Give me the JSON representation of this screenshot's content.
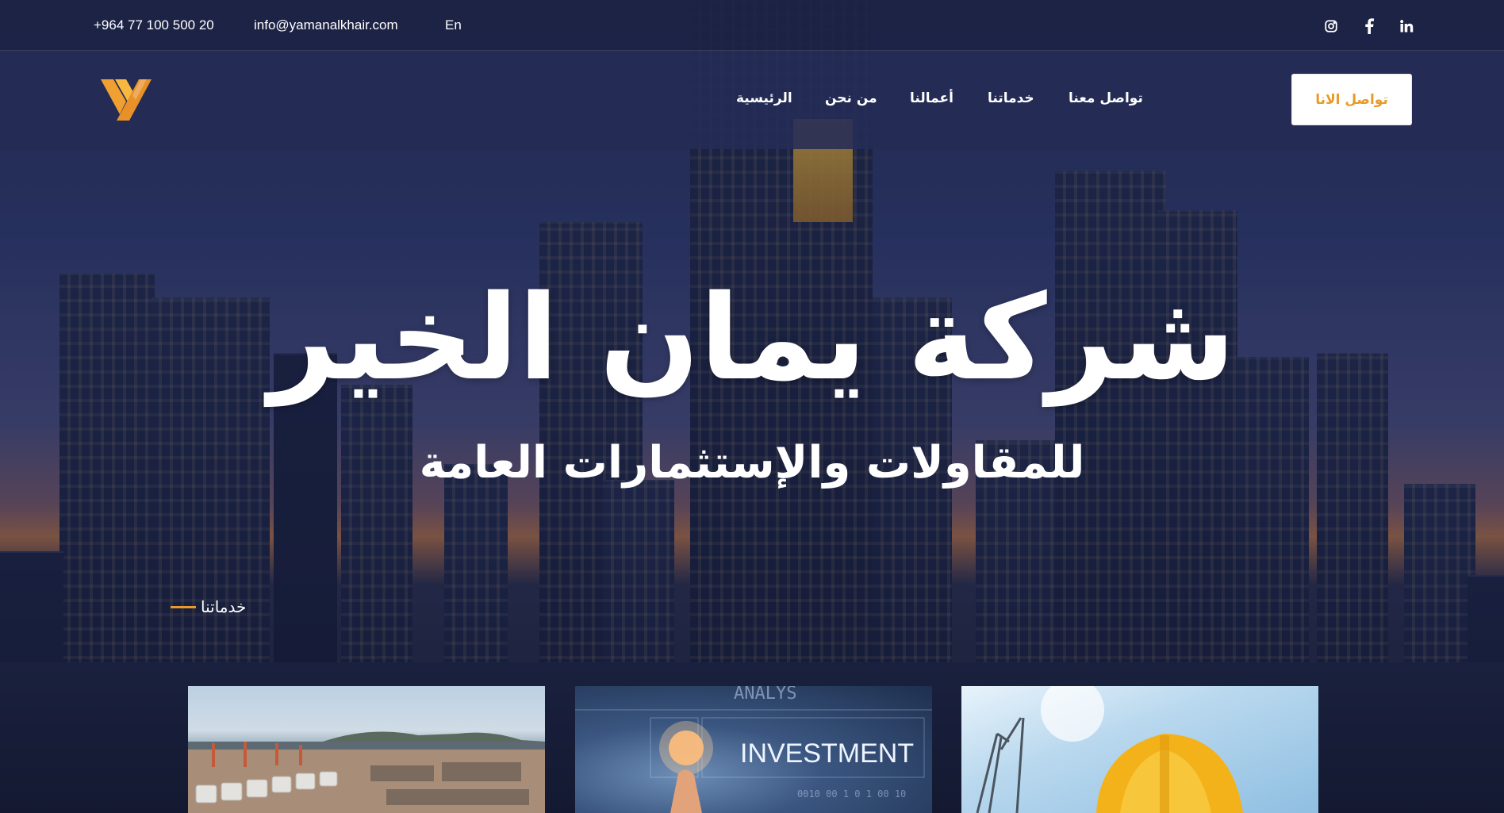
{
  "topbar": {
    "phone": "+964 77 100 500 20",
    "email": "info@yamanalkhair.com",
    "language": "En",
    "social": [
      "instagram-icon",
      "facebook-icon",
      "linkedin-icon"
    ]
  },
  "nav": {
    "items": [
      "الرئيسية",
      "من نحن",
      "أعمالنا",
      "خدماتنا",
      "تواصل معنا"
    ],
    "cta": "تواصل الانا"
  },
  "hero": {
    "title": "شركة يمان الخير",
    "subtitle": "للمقاولات والإستثمارات العامة"
  },
  "services": {
    "label": "خدماتنا",
    "cards": [
      {
        "image": "port-terminal-photo"
      },
      {
        "image": "investment-photo",
        "overlay_text": "INVESTMENT"
      },
      {
        "image": "construction-helmet-photo"
      }
    ]
  },
  "colors": {
    "accent": "#e89a2a",
    "topbar": "#1c2244",
    "navbar": "#242c56"
  }
}
